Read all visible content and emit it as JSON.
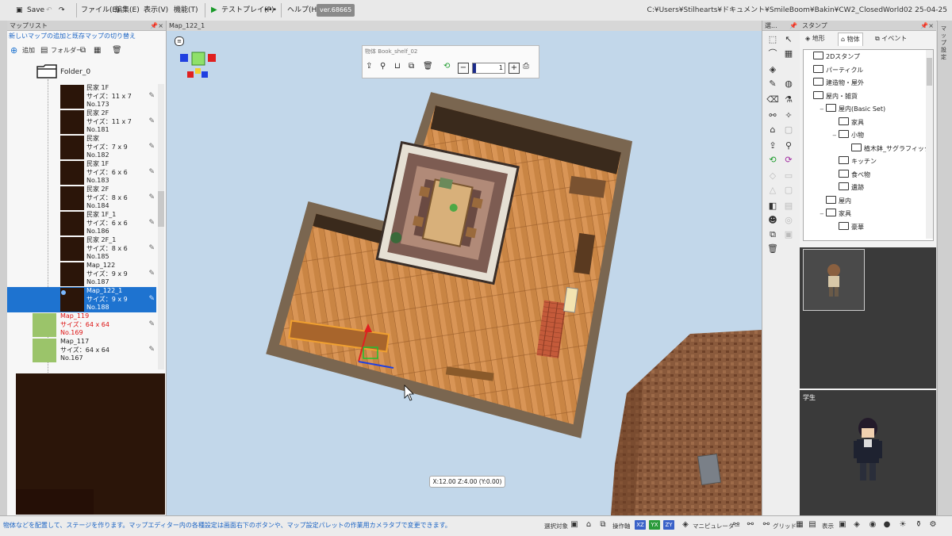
{
  "menubar": {
    "save": "Save",
    "file": "ファイル(E)",
    "edit": "編集(E)",
    "view": "表示(V)",
    "function": "機能(T)",
    "testplay": "テストプレイ(P)",
    "more": "•••",
    "help": "ヘルプ(H)",
    "version": "ver.68665",
    "path": "C:¥Users¥Stilhearts¥ドキュメント¥SmileBoom¥Bakin¥CW2_ClosedWorld02 25-04-25"
  },
  "maplist": {
    "title": "マップリスト",
    "subtitle": "新しいマップの追加と既存マップの切り替え",
    "add": "追加",
    "folder_btn": "フォルダー",
    "folder_name": "Folder_0",
    "items": [
      {
        "name": "民家 1F",
        "size": "サイズ：11 x 7",
        "no": "No.173"
      },
      {
        "name": "民家 2F",
        "size": "サイズ：11 x 7",
        "no": "No.181"
      },
      {
        "name": "民家",
        "size": "サイズ：7 x 9",
        "no": "No.182"
      },
      {
        "name": "民家 1F",
        "size": "サイズ：6 x 6",
        "no": "No.183"
      },
      {
        "name": "民家 2F",
        "size": "サイズ：8 x 6",
        "no": "No.184"
      },
      {
        "name": "民家 1F_1",
        "size": "サイズ：6 x 6",
        "no": "No.186"
      },
      {
        "name": "民家 2F_1",
        "size": "サイズ：8 x 6",
        "no": "No.185"
      },
      {
        "name": "Map_122",
        "size": "サイズ：9 x 9",
        "no": "No.187"
      },
      {
        "name": "Map_122_1",
        "size": "サイズ：9 x 9",
        "no": "No.188"
      },
      {
        "name": "Map_119",
        "size": "サイズ：64 x 64",
        "no": "No.169"
      },
      {
        "name": "Map_117",
        "size": "サイズ：64 x 64",
        "no": "No.167"
      }
    ]
  },
  "viewport": {
    "tab": "Map_122_1",
    "object_name": "物体 Book_shelf_02",
    "stepper_value": "1",
    "coords": "X:12.00 Z:4.00 (Y:0.00)"
  },
  "tools_title": "選...",
  "stamp": {
    "title": "スタンプ",
    "tabs": [
      "地形",
      "物体",
      "イベント"
    ],
    "tree": [
      {
        "label": "2Dスタンプ",
        "depth": 0,
        "expander": ""
      },
      {
        "label": "パーティクル",
        "depth": 0,
        "expander": ""
      },
      {
        "label": "建造物・屋外",
        "depth": 0,
        "expander": ""
      },
      {
        "label": "屋内・雑貨",
        "depth": 0,
        "expander": ""
      },
      {
        "label": "屋内(Basic Set)",
        "depth": 1,
        "expander": "−"
      },
      {
        "label": "家具",
        "depth": 2,
        "expander": ""
      },
      {
        "label": "小物",
        "depth": 2,
        "expander": "−"
      },
      {
        "label": "植木鉢_サグラフィック",
        "depth": 3,
        "expander": ""
      },
      {
        "label": "キッチン",
        "depth": 2,
        "expander": ""
      },
      {
        "label": "食べ物",
        "depth": 2,
        "expander": ""
      },
      {
        "label": "遺跡",
        "depth": 2,
        "expander": ""
      },
      {
        "label": "屋内",
        "depth": 1,
        "expander": ""
      },
      {
        "label": "家具",
        "depth": 1,
        "expander": "−"
      },
      {
        "label": "豪華",
        "depth": 2,
        "expander": ""
      }
    ],
    "character_label": "学生"
  },
  "right_strip": "マップ設定",
  "status": {
    "message": "物体などを配置して、ステージを作ります。マップエディター内の各種設定は画面右下のボタンや、マップ設定パレットの作業用カメラタブで変更できます。",
    "select_target": "選択対象",
    "operation_axis": "操作軸",
    "axis_xz": "XZ",
    "axis_yx": "YX",
    "axis_zy": "ZY",
    "manipulator": "マニピュレーター",
    "grid": "グリッド",
    "display": "表示"
  },
  "colors": {
    "accent": "#1e73d0",
    "selected_row": "#1e73d0",
    "viewport_bg": "#c2d7ea",
    "red_text": "#d11111"
  }
}
